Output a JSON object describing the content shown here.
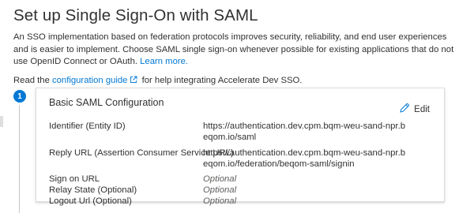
{
  "page": {
    "title": "Set up Single Sign-On with SAML",
    "description": "An SSO implementation based on federation protocols improves security, reliability, and end user experiences and is easier to implement. Choose SAML single sign-on whenever possible for existing applications that do not use OpenID Connect or OAuth.",
    "learn_more": "Learn more.",
    "guide_prefix": "Read the",
    "guide_link": "configuration guide",
    "guide_suffix": "for help integrating Accelerate Dev SSO."
  },
  "step": {
    "number": "1",
    "title": "Basic SAML Configuration",
    "edit_label": "Edit",
    "fields": [
      {
        "label": "Identifier (Entity ID)",
        "value": "https://authentication.dev.cpm.bqm-weu-sand-npr.beqom.io/saml"
      },
      {
        "label": "Reply URL (Assertion Consumer Service URL)",
        "value": "https://authentication.dev.cpm.bqm-weu-sand-npr.beqom.io/federation/beqom-saml/signin"
      },
      {
        "label": "Sign on URL",
        "value": "Optional"
      },
      {
        "label": "Relay State (Optional)",
        "value": "Optional"
      },
      {
        "label": "Logout Url (Optional)",
        "value": "Optional"
      }
    ]
  },
  "icons": {
    "external_link": "external-link-icon",
    "edit": "pencil-icon"
  },
  "colors": {
    "accent": "#0078d4",
    "text": "#323130",
    "muted": "#605e5c"
  }
}
